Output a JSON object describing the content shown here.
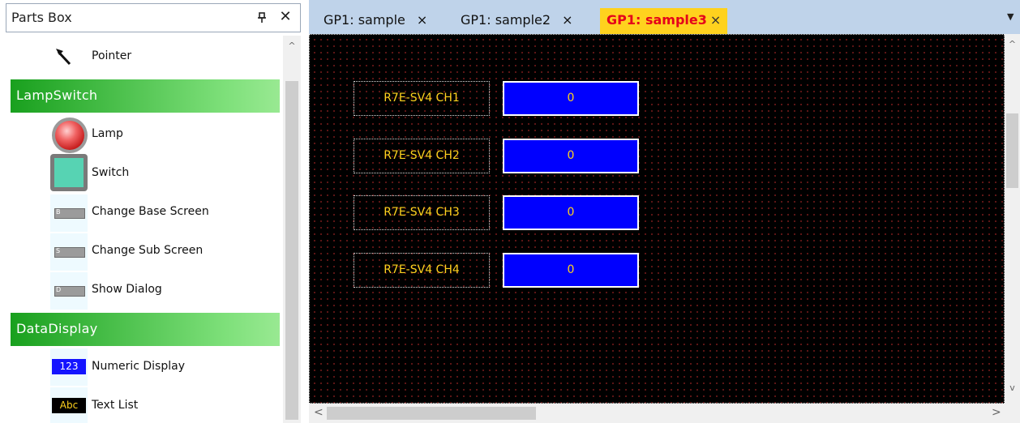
{
  "parts_box": {
    "title": "Parts Box",
    "pin_glyph": "ᾧ",
    "close_glyph": "✕",
    "items": {
      "pointer": {
        "label": "Pointer",
        "icon": "pointer-arrow-icon"
      },
      "lamp": {
        "label": "Lamp",
        "icon": "lamp-icon"
      },
      "switch": {
        "label": "Switch",
        "icon": "switch-icon"
      },
      "change_base_screen": {
        "label": "Change Base Screen",
        "icon": "change-base-screen-icon",
        "icon_text": "B"
      },
      "change_sub_screen": {
        "label": "Change Sub Screen",
        "icon": "change-sub-screen-icon",
        "icon_text": "S"
      },
      "show_dialog": {
        "label": "Show Dialog",
        "icon": "show-dialog-icon",
        "icon_text": "D"
      },
      "numeric_display": {
        "label": "Numeric Display",
        "icon": "numeric-display-icon",
        "icon_text": "123"
      },
      "text_list": {
        "label": "Text List",
        "icon": "text-list-icon",
        "icon_text": "Abc"
      }
    },
    "groups": {
      "lampswitch": "LampSwitch",
      "datadisplay": "DataDisplay"
    }
  },
  "tabs": [
    {
      "label": "GP1: sample",
      "close": "×"
    },
    {
      "label": "GP1: sample2",
      "close": "×"
    },
    {
      "label": "GP1: sample3",
      "close": "×",
      "active": true
    }
  ],
  "tab_dropdown_glyph": "▼",
  "canvas": {
    "channels": [
      {
        "label": "R7E-SV4 CH1",
        "value": "0"
      },
      {
        "label": "R7E-SV4 CH2",
        "value": "0"
      },
      {
        "label": "R7E-SV4 CH3",
        "value": "0"
      },
      {
        "label": "R7E-SV4 CH4",
        "value": "0"
      }
    ]
  },
  "scroll": {
    "up": "^",
    "down": "v",
    "left": "<",
    "right": ">"
  },
  "colors": {
    "group_header": "#19a01e",
    "active_tab_bg": "#ffd21e",
    "active_tab_text": "#e5001b",
    "canvas_bg": "#000000",
    "label_text": "#ffd21e",
    "value_bg": "#0000ff"
  }
}
